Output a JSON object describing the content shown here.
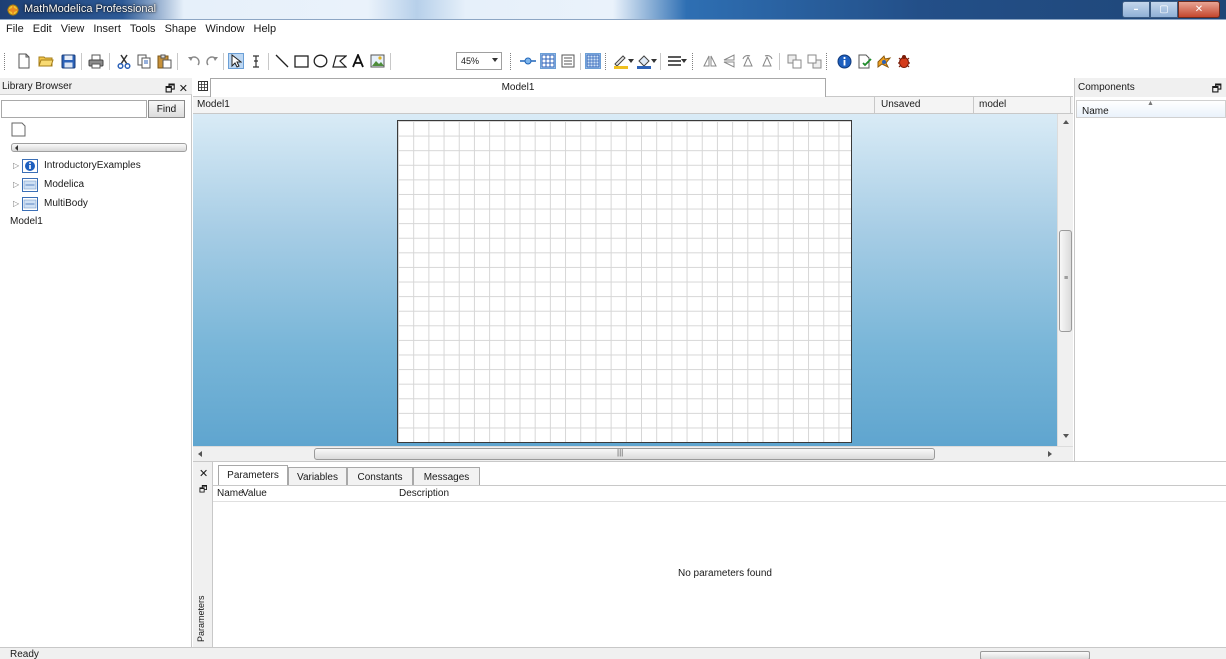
{
  "window": {
    "title": "MathModelica Professional"
  },
  "menu": [
    "File",
    "Edit",
    "View",
    "Insert",
    "Tools",
    "Shape",
    "Window",
    "Help"
  ],
  "toolbar": {
    "zoom": "45%"
  },
  "library_browser": {
    "title": "Library Browser",
    "search_value": "",
    "find_label": "Find",
    "tree": [
      {
        "label": "IntroductoryExamples",
        "icon": "info-icon"
      },
      {
        "label": "Modelica",
        "icon": "library-icon"
      },
      {
        "label": "MultiBody",
        "icon": "library-icon"
      }
    ],
    "model_item": "Model1"
  },
  "editor": {
    "tab_label": "Model1",
    "model_name": "Model1",
    "model_kind": "model",
    "save_state": "Unsaved"
  },
  "components": {
    "title": "Components",
    "column_name": "Name"
  },
  "bottom": {
    "tabs": [
      "Parameters",
      "Variables",
      "Constants",
      "Messages"
    ],
    "columns": [
      "Name",
      "Value",
      "Description"
    ],
    "empty_message": "No parameters found",
    "side_label": "Parameters"
  },
  "status": {
    "text": "Ready"
  }
}
